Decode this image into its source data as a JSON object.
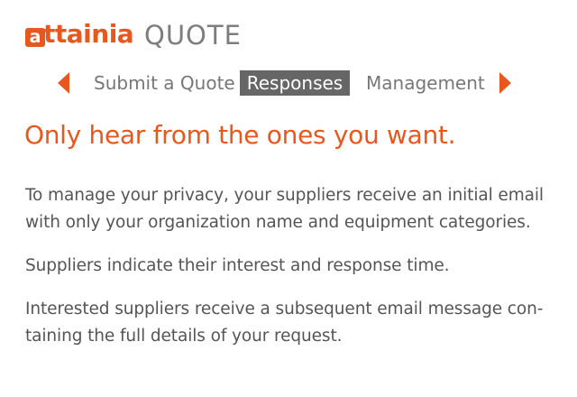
{
  "brand": {
    "logo_letter": "a",
    "logo_text": "ttainia",
    "product": "QUOTE",
    "accent_color": "#e8581e"
  },
  "nav": {
    "prev_icon": "triangle-left",
    "next_icon": "triangle-right",
    "tabs": [
      {
        "label": "Submit a Quote",
        "active": false
      },
      {
        "label": "Responses",
        "active": true
      },
      {
        "label": "Management",
        "active": false
      }
    ],
    "active_bg": "#666666"
  },
  "content": {
    "headline": "Only hear from the ones you want.",
    "paragraphs": [
      {
        "line1": "To manage your privacy, your suppliers receive an initial email",
        "line2": "with only your organization name and equipment categories."
      },
      {
        "line1": "Suppliers indicate their interest and response time.",
        "line2": ""
      },
      {
        "line1": "Interested suppliers receive a subsequent email message con-",
        "line2": "taining the full details of your request."
      }
    ]
  }
}
